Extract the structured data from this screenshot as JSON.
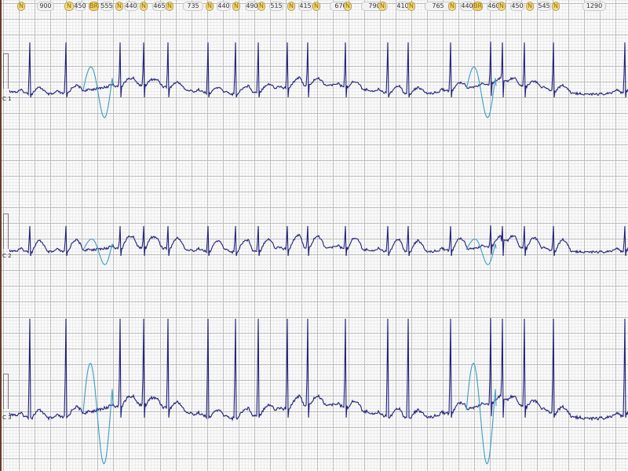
{
  "annotations": [
    {
      "kind": "beat",
      "text": "N"
    },
    {
      "kind": "rr",
      "text": "900"
    },
    {
      "kind": "beat",
      "text": "N"
    },
    {
      "kind": "rr",
      "text": "450"
    },
    {
      "kind": "beat",
      "text": "BR"
    },
    {
      "kind": "rr",
      "text": "555"
    },
    {
      "kind": "beat",
      "text": "N"
    },
    {
      "kind": "rr",
      "text": "440"
    },
    {
      "kind": "beat",
      "text": "N"
    },
    {
      "kind": "rr",
      "text": "465"
    },
    {
      "kind": "beat",
      "text": "N"
    },
    {
      "kind": "rr",
      "text": "735"
    },
    {
      "kind": "beat",
      "text": "N"
    },
    {
      "kind": "rr",
      "text": "440"
    },
    {
      "kind": "beat",
      "text": "N"
    },
    {
      "kind": "rr",
      "text": "490"
    },
    {
      "kind": "beat",
      "text": "N"
    },
    {
      "kind": "rr",
      "text": "515"
    },
    {
      "kind": "beat",
      "text": "N"
    },
    {
      "kind": "rr",
      "text": "415"
    },
    {
      "kind": "beat",
      "text": "N"
    },
    {
      "kind": "rr",
      "text": "670"
    },
    {
      "kind": "beat",
      "text": "N"
    },
    {
      "kind": "rr",
      "text": "790"
    },
    {
      "kind": "beat",
      "text": "N"
    },
    {
      "kind": "rr",
      "text": "410"
    },
    {
      "kind": "beat",
      "text": "N"
    },
    {
      "kind": "rr",
      "text": "765"
    },
    {
      "kind": "beat",
      "text": "N"
    },
    {
      "kind": "rr",
      "text": "440"
    },
    {
      "kind": "beat",
      "text": "BR"
    },
    {
      "kind": "rr",
      "text": "460"
    },
    {
      "kind": "beat",
      "text": "N"
    },
    {
      "kind": "rr",
      "text": "450"
    },
    {
      "kind": "beat",
      "text": "N"
    },
    {
      "kind": "rr",
      "text": "545"
    },
    {
      "kind": "beat",
      "text": "N"
    },
    {
      "kind": "rr",
      "text": "1290"
    }
  ],
  "channels": [
    {
      "label": "C 1"
    },
    {
      "label": "C 2"
    },
    {
      "label": "C 3"
    }
  ],
  "colors": {
    "trace": "#1f1f7a",
    "highlight": "#3a9fc0",
    "beat_badge": "#f4dc84",
    "grid_major": "#bdbdbd",
    "grid_minor": "#ececec",
    "border": "#6b3b2b"
  }
}
